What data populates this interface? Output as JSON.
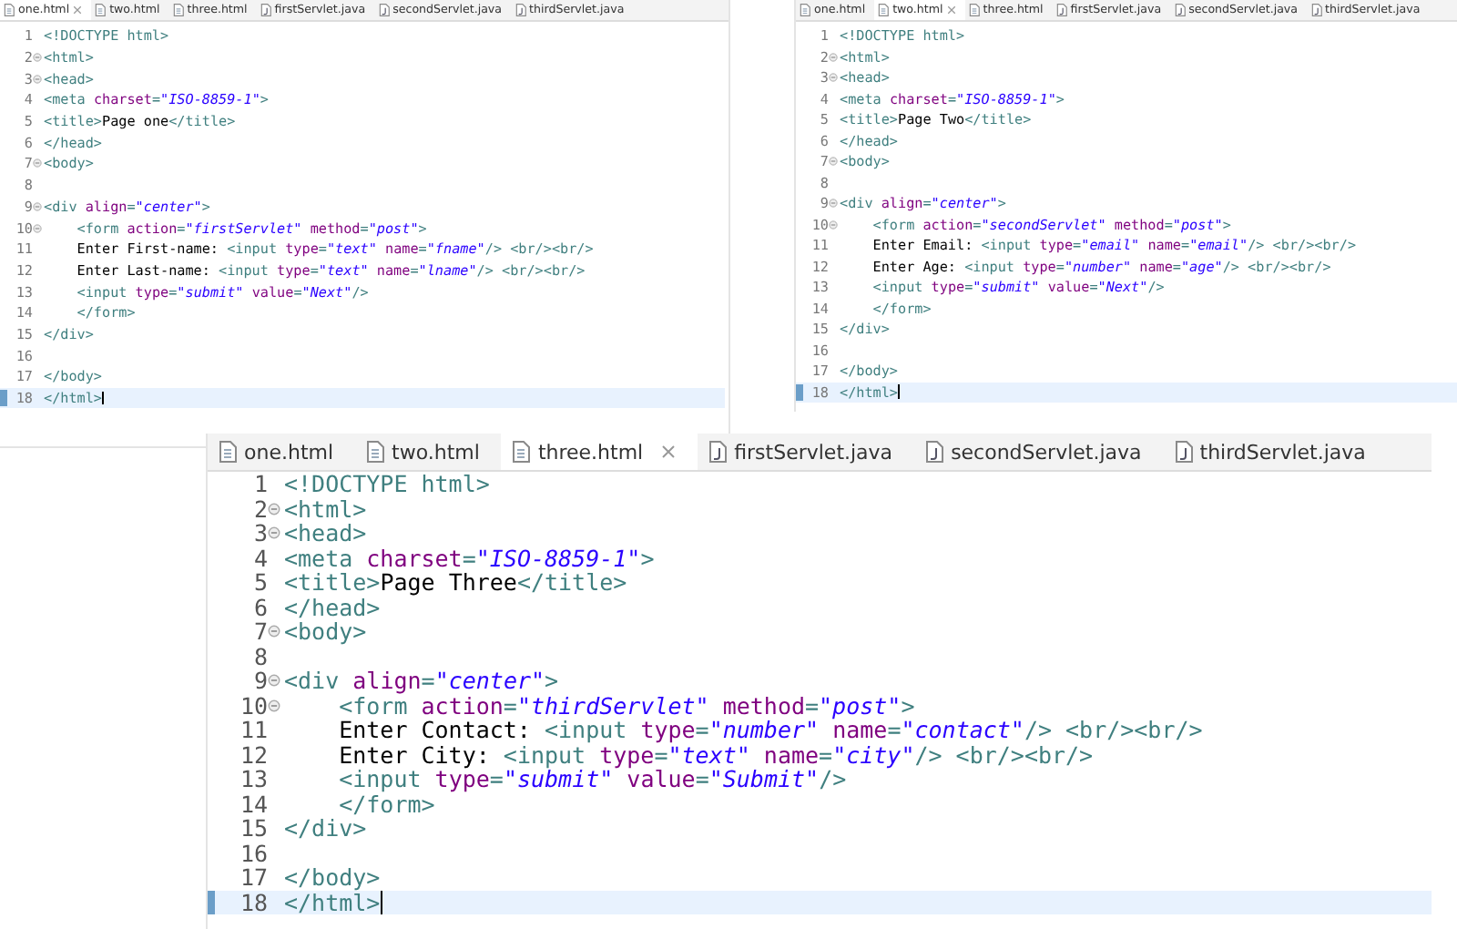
{
  "editors": [
    {
      "tabs": [
        {
          "label": "one.html",
          "kind": "html",
          "selected": true
        },
        {
          "label": "two.html",
          "kind": "html",
          "selected": false
        },
        {
          "label": "three.html",
          "kind": "html",
          "selected": false
        },
        {
          "label": "firstServlet.java",
          "kind": "java",
          "selected": false
        },
        {
          "label": "secondServlet.java",
          "kind": "java",
          "selected": false
        },
        {
          "label": "thirdServlet.java",
          "kind": "java",
          "selected": false
        }
      ],
      "lines": [
        {
          "number": "1",
          "folding": false,
          "current": false,
          "tokens": [
            {
              "kind": "tag",
              "text": "<!DOCTYPE html>"
            }
          ]
        },
        {
          "number": "2",
          "folding": true,
          "current": false,
          "tokens": [
            {
              "kind": "tag",
              "text": "<html>"
            }
          ]
        },
        {
          "number": "3",
          "folding": true,
          "current": false,
          "tokens": [
            {
              "kind": "tag",
              "text": "<head>"
            }
          ]
        },
        {
          "number": "4",
          "folding": false,
          "current": false,
          "tokens": [
            {
              "kind": "tag",
              "text": "<meta "
            },
            {
              "kind": "attr",
              "text": "charset"
            },
            {
              "kind": "tag",
              "text": "="
            },
            {
              "kind": "str",
              "text": "\"ISO-8859-1\""
            },
            {
              "kind": "tag",
              "text": ">"
            }
          ]
        },
        {
          "number": "5",
          "folding": false,
          "current": false,
          "tokens": [
            {
              "kind": "tag",
              "text": "<title>"
            },
            {
              "kind": "text",
              "text": "Page one"
            },
            {
              "kind": "tag",
              "text": "</title>"
            }
          ]
        },
        {
          "number": "6",
          "folding": false,
          "current": false,
          "tokens": [
            {
              "kind": "tag",
              "text": "</head>"
            }
          ]
        },
        {
          "number": "7",
          "folding": true,
          "current": false,
          "tokens": [
            {
              "kind": "tag",
              "text": "<body>"
            }
          ]
        },
        {
          "number": "8",
          "folding": false,
          "current": false
        },
        {
          "number": "9",
          "folding": true,
          "current": false,
          "tokens": [
            {
              "kind": "tag",
              "text": "<div "
            },
            {
              "kind": "attr",
              "text": "align"
            },
            {
              "kind": "tag",
              "text": "="
            },
            {
              "kind": "str",
              "text": "\"center\""
            },
            {
              "kind": "tag",
              "text": ">"
            }
          ]
        },
        {
          "number": "10",
          "folding": true,
          "current": false,
          "tokens": [
            {
              "kind": "tag",
              "text": "    <form "
            },
            {
              "kind": "attr",
              "text": "action"
            },
            {
              "kind": "tag",
              "text": "="
            },
            {
              "kind": "str",
              "text": "\"firstServlet\""
            },
            {
              "kind": "attr",
              "text": " method"
            },
            {
              "kind": "tag",
              "text": "="
            },
            {
              "kind": "str",
              "text": "\"post\""
            },
            {
              "kind": "tag",
              "text": ">"
            }
          ]
        },
        {
          "number": "11",
          "folding": false,
          "current": false,
          "tokens": [
            {
              "kind": "text",
              "text": "    Enter First-name: "
            },
            {
              "kind": "tag",
              "text": "<input "
            },
            {
              "kind": "attr",
              "text": "type"
            },
            {
              "kind": "tag",
              "text": "="
            },
            {
              "kind": "str",
              "text": "\"text\""
            },
            {
              "kind": "attr",
              "text": " name"
            },
            {
              "kind": "tag",
              "text": "="
            },
            {
              "kind": "str",
              "text": "\"fname\""
            },
            {
              "kind": "tag",
              "text": "/> <br/><br/>"
            }
          ]
        },
        {
          "number": "12",
          "folding": false,
          "current": false,
          "tokens": [
            {
              "kind": "text",
              "text": "    Enter Last-name: "
            },
            {
              "kind": "tag",
              "text": "<input "
            },
            {
              "kind": "attr",
              "text": "type"
            },
            {
              "kind": "tag",
              "text": "="
            },
            {
              "kind": "str",
              "text": "\"text\""
            },
            {
              "kind": "attr",
              "text": " name"
            },
            {
              "kind": "tag",
              "text": "="
            },
            {
              "kind": "str",
              "text": "\"lname\""
            },
            {
              "kind": "tag",
              "text": "/> <br/><br/>"
            }
          ]
        },
        {
          "number": "13",
          "folding": false,
          "current": false,
          "tokens": [
            {
              "kind": "tag",
              "text": "    <input "
            },
            {
              "kind": "attr",
              "text": "type"
            },
            {
              "kind": "tag",
              "text": "="
            },
            {
              "kind": "str",
              "text": "\"submit\""
            },
            {
              "kind": "attr",
              "text": " value"
            },
            {
              "kind": "tag",
              "text": "="
            },
            {
              "kind": "str",
              "text": "\"Next\""
            },
            {
              "kind": "tag",
              "text": "/>"
            }
          ]
        },
        {
          "number": "14",
          "folding": false,
          "current": false,
          "tokens": [
            {
              "kind": "tag",
              "text": "    </form>"
            }
          ]
        },
        {
          "number": "15",
          "folding": false,
          "current": false,
          "tokens": [
            {
              "kind": "tag",
              "text": "</div>"
            }
          ]
        },
        {
          "number": "16",
          "folding": false,
          "current": false
        },
        {
          "number": "17",
          "folding": false,
          "current": false,
          "tokens": [
            {
              "kind": "tag",
              "text": "</body>"
            }
          ]
        },
        {
          "number": "18",
          "folding": false,
          "current": true,
          "tokens": [
            {
              "kind": "tag",
              "text": "</html>"
            }
          ]
        }
      ]
    },
    {
      "tabs": [
        {
          "label": "one.html",
          "kind": "html",
          "selected": false
        },
        {
          "label": "two.html",
          "kind": "html",
          "selected": true
        },
        {
          "label": "three.html",
          "kind": "html",
          "selected": false
        },
        {
          "label": "firstServlet.java",
          "kind": "java",
          "selected": false
        },
        {
          "label": "secondServlet.java",
          "kind": "java",
          "selected": false
        },
        {
          "label": "thirdServlet.java",
          "kind": "java",
          "selected": false
        }
      ],
      "lines": [
        {
          "number": "1",
          "folding": false,
          "current": false,
          "tokens": [
            {
              "kind": "tag",
              "text": "<!DOCTYPE html>"
            }
          ]
        },
        {
          "number": "2",
          "folding": true,
          "current": false,
          "tokens": [
            {
              "kind": "tag",
              "text": "<html>"
            }
          ]
        },
        {
          "number": "3",
          "folding": true,
          "current": false,
          "tokens": [
            {
              "kind": "tag",
              "text": "<head>"
            }
          ]
        },
        {
          "number": "4",
          "folding": false,
          "current": false,
          "tokens": [
            {
              "kind": "tag",
              "text": "<meta "
            },
            {
              "kind": "attr",
              "text": "charset"
            },
            {
              "kind": "tag",
              "text": "="
            },
            {
              "kind": "str",
              "text": "\"ISO-8859-1\""
            },
            {
              "kind": "tag",
              "text": ">"
            }
          ]
        },
        {
          "number": "5",
          "folding": false,
          "current": false,
          "tokens": [
            {
              "kind": "tag",
              "text": "<title>"
            },
            {
              "kind": "text",
              "text": "Page Two"
            },
            {
              "kind": "tag",
              "text": "</title>"
            }
          ]
        },
        {
          "number": "6",
          "folding": false,
          "current": false,
          "tokens": [
            {
              "kind": "tag",
              "text": "</head>"
            }
          ]
        },
        {
          "number": "7",
          "folding": true,
          "current": false,
          "tokens": [
            {
              "kind": "tag",
              "text": "<body>"
            }
          ]
        },
        {
          "number": "8",
          "folding": false,
          "current": false
        },
        {
          "number": "9",
          "folding": true,
          "current": false,
          "tokens": [
            {
              "kind": "tag",
              "text": "<div "
            },
            {
              "kind": "attr",
              "text": "align"
            },
            {
              "kind": "tag",
              "text": "="
            },
            {
              "kind": "str",
              "text": "\"center\""
            },
            {
              "kind": "tag",
              "text": ">"
            }
          ]
        },
        {
          "number": "10",
          "folding": true,
          "current": false,
          "tokens": [
            {
              "kind": "tag",
              "text": "    <form "
            },
            {
              "kind": "attr",
              "text": "action"
            },
            {
              "kind": "tag",
              "text": "="
            },
            {
              "kind": "str",
              "text": "\"secondServlet\""
            },
            {
              "kind": "attr",
              "text": " method"
            },
            {
              "kind": "tag",
              "text": "="
            },
            {
              "kind": "str",
              "text": "\"post\""
            },
            {
              "kind": "tag",
              "text": ">"
            }
          ]
        },
        {
          "number": "11",
          "folding": false,
          "current": false,
          "tokens": [
            {
              "kind": "text",
              "text": "    Enter Email: "
            },
            {
              "kind": "tag",
              "text": "<input "
            },
            {
              "kind": "attr",
              "text": "type"
            },
            {
              "kind": "tag",
              "text": "="
            },
            {
              "kind": "str",
              "text": "\"email\""
            },
            {
              "kind": "attr",
              "text": " name"
            },
            {
              "kind": "tag",
              "text": "="
            },
            {
              "kind": "str",
              "text": "\"email\""
            },
            {
              "kind": "tag",
              "text": "/> <br/><br/>"
            }
          ]
        },
        {
          "number": "12",
          "folding": false,
          "current": false,
          "tokens": [
            {
              "kind": "text",
              "text": "    Enter Age: "
            },
            {
              "kind": "tag",
              "text": "<input "
            },
            {
              "kind": "attr",
              "text": "type"
            },
            {
              "kind": "tag",
              "text": "="
            },
            {
              "kind": "str",
              "text": "\"number\""
            },
            {
              "kind": "attr",
              "text": " name"
            },
            {
              "kind": "tag",
              "text": "="
            },
            {
              "kind": "str",
              "text": "\"age\""
            },
            {
              "kind": "tag",
              "text": "/> <br/><br/>"
            }
          ]
        },
        {
          "number": "13",
          "folding": false,
          "current": false,
          "tokens": [
            {
              "kind": "tag",
              "text": "    <input "
            },
            {
              "kind": "attr",
              "text": "type"
            },
            {
              "kind": "tag",
              "text": "="
            },
            {
              "kind": "str",
              "text": "\"submit\""
            },
            {
              "kind": "attr",
              "text": " value"
            },
            {
              "kind": "tag",
              "text": "="
            },
            {
              "kind": "str",
              "text": "\"Next\""
            },
            {
              "kind": "tag",
              "text": "/>"
            }
          ]
        },
        {
          "number": "14",
          "folding": false,
          "current": false,
          "tokens": [
            {
              "kind": "tag",
              "text": "    </form>"
            }
          ]
        },
        {
          "number": "15",
          "folding": false,
          "current": false,
          "tokens": [
            {
              "kind": "tag",
              "text": "</div>"
            }
          ]
        },
        {
          "number": "16",
          "folding": false,
          "current": false
        },
        {
          "number": "17",
          "folding": false,
          "current": false,
          "tokens": [
            {
              "kind": "tag",
              "text": "</body>"
            }
          ]
        },
        {
          "number": "18",
          "folding": false,
          "current": true,
          "tokens": [
            {
              "kind": "tag",
              "text": "</html>"
            }
          ]
        }
      ]
    },
    {
      "tabs": [
        {
          "label": "one.html",
          "kind": "html",
          "selected": false
        },
        {
          "label": "two.html",
          "kind": "html",
          "selected": false
        },
        {
          "label": "three.html",
          "kind": "html",
          "selected": true
        },
        {
          "label": "firstServlet.java",
          "kind": "java",
          "selected": false
        },
        {
          "label": "secondServlet.java",
          "kind": "java",
          "selected": false
        },
        {
          "label": "thirdServlet.java",
          "kind": "java",
          "selected": false
        }
      ],
      "lines": [
        {
          "number": "1",
          "folding": false,
          "current": false,
          "tokens": [
            {
              "kind": "tag",
              "text": "<!DOCTYPE html>"
            }
          ]
        },
        {
          "number": "2",
          "folding": true,
          "current": false,
          "tokens": [
            {
              "kind": "tag",
              "text": "<html>"
            }
          ]
        },
        {
          "number": "3",
          "folding": true,
          "current": false,
          "tokens": [
            {
              "kind": "tag",
              "text": "<head>"
            }
          ]
        },
        {
          "number": "4",
          "folding": false,
          "current": false,
          "tokens": [
            {
              "kind": "tag",
              "text": "<meta "
            },
            {
              "kind": "attr",
              "text": "charset"
            },
            {
              "kind": "tag",
              "text": "="
            },
            {
              "kind": "str",
              "text": "\"ISO-8859-1\""
            },
            {
              "kind": "tag",
              "text": ">"
            }
          ]
        },
        {
          "number": "5",
          "folding": false,
          "current": false,
          "tokens": [
            {
              "kind": "tag",
              "text": "<title>"
            },
            {
              "kind": "text",
              "text": "Page Three"
            },
            {
              "kind": "tag",
              "text": "</title>"
            }
          ]
        },
        {
          "number": "6",
          "folding": false,
          "current": false,
          "tokens": [
            {
              "kind": "tag",
              "text": "</head>"
            }
          ]
        },
        {
          "number": "7",
          "folding": true,
          "current": false,
          "tokens": [
            {
              "kind": "tag",
              "text": "<body>"
            }
          ]
        },
        {
          "number": "8",
          "folding": false,
          "current": false
        },
        {
          "number": "9",
          "folding": true,
          "current": false,
          "tokens": [
            {
              "kind": "tag",
              "text": "<div "
            },
            {
              "kind": "attr",
              "text": "align"
            },
            {
              "kind": "tag",
              "text": "="
            },
            {
              "kind": "str",
              "text": "\"center\""
            },
            {
              "kind": "tag",
              "text": ">"
            }
          ]
        },
        {
          "number": "10",
          "folding": true,
          "current": false,
          "tokens": [
            {
              "kind": "tag",
              "text": "    <form "
            },
            {
              "kind": "attr",
              "text": "action"
            },
            {
              "kind": "tag",
              "text": "="
            },
            {
              "kind": "str",
              "text": "\"thirdServlet\""
            },
            {
              "kind": "attr",
              "text": " method"
            },
            {
              "kind": "tag",
              "text": "="
            },
            {
              "kind": "str",
              "text": "\"post\""
            },
            {
              "kind": "tag",
              "text": ">"
            }
          ]
        },
        {
          "number": "11",
          "folding": false,
          "current": false,
          "tokens": [
            {
              "kind": "text",
              "text": "    Enter Contact: "
            },
            {
              "kind": "tag",
              "text": "<input "
            },
            {
              "kind": "attr",
              "text": "type"
            },
            {
              "kind": "tag",
              "text": "="
            },
            {
              "kind": "str",
              "text": "\"number\""
            },
            {
              "kind": "attr",
              "text": " name"
            },
            {
              "kind": "tag",
              "text": "="
            },
            {
              "kind": "str",
              "text": "\"contact\""
            },
            {
              "kind": "tag",
              "text": "/> <br/><br/>"
            }
          ]
        },
        {
          "number": "12",
          "folding": false,
          "current": false,
          "tokens": [
            {
              "kind": "text",
              "text": "    Enter City: "
            },
            {
              "kind": "tag",
              "text": "<input "
            },
            {
              "kind": "attr",
              "text": "type"
            },
            {
              "kind": "tag",
              "text": "="
            },
            {
              "kind": "str",
              "text": "\"text\""
            },
            {
              "kind": "attr",
              "text": " name"
            },
            {
              "kind": "tag",
              "text": "="
            },
            {
              "kind": "str",
              "text": "\"city\""
            },
            {
              "kind": "tag",
              "text": "/> <br/><br/>"
            }
          ]
        },
        {
          "number": "13",
          "folding": false,
          "current": false,
          "tokens": [
            {
              "kind": "tag",
              "text": "    <input "
            },
            {
              "kind": "attr",
              "text": "type"
            },
            {
              "kind": "tag",
              "text": "="
            },
            {
              "kind": "str",
              "text": "\"submit\""
            },
            {
              "kind": "attr",
              "text": " value"
            },
            {
              "kind": "tag",
              "text": "="
            },
            {
              "kind": "str",
              "text": "\"Submit\""
            },
            {
              "kind": "tag",
              "text": "/>"
            }
          ]
        },
        {
          "number": "14",
          "folding": false,
          "current": false,
          "tokens": [
            {
              "kind": "tag",
              "text": "    </form>"
            }
          ]
        },
        {
          "number": "15",
          "folding": false,
          "current": false,
          "tokens": [
            {
              "kind": "tag",
              "text": "</div>"
            }
          ]
        },
        {
          "number": "16",
          "folding": false,
          "current": false
        },
        {
          "number": "17",
          "folding": false,
          "current": false,
          "tokens": [
            {
              "kind": "tag",
              "text": "</body>"
            }
          ]
        },
        {
          "number": "18",
          "folding": false,
          "current": true,
          "tokens": [
            {
              "kind": "tag",
              "text": "</html>"
            }
          ]
        }
      ]
    }
  ]
}
